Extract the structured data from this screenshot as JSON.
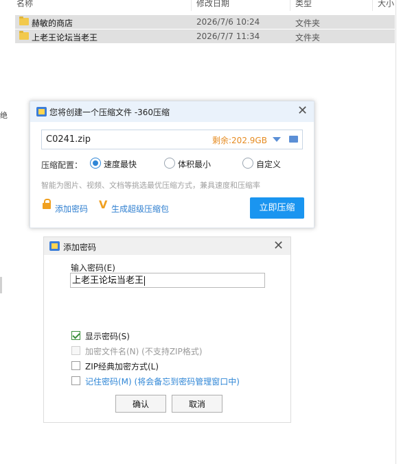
{
  "explorer": {
    "columns": [
      "名称",
      "修改日期",
      "类型",
      "大小"
    ],
    "files": [
      {
        "name": "赫敏的商店",
        "date": "2026/7/6 10:24",
        "type": "文件夹"
      },
      {
        "name": "上老王论坛当老王",
        "date": "2026/7/7 11:34",
        "type": "文件夹"
      }
    ],
    "side_char": "绝"
  },
  "compress_dialog": {
    "title": "您将创建一个压缩文件 -360压缩",
    "filename": "C0241.zip",
    "free_space": "剩余:202.9GB",
    "config_label": "压缩配置：",
    "options": [
      "速度最快",
      "体积最小",
      "自定义"
    ],
    "selected_option": "速度最快",
    "hint": "智能为图片、视频、文档等挑选最优压缩方式，兼具速度和压缩率",
    "add_password": "添加密码",
    "super_package": "生成超级压缩包",
    "compress_button": "立即压缩",
    "colors": {
      "primary": "#1a95f0",
      "accent": "#e58a1f"
    }
  },
  "password_dialog": {
    "title": "添加密码",
    "input_label": "输入密码(E)",
    "password_value": "上老王论坛当老王",
    "checkboxes": {
      "show_password": {
        "label": "显示密码(S)",
        "checked": true
      },
      "encrypt_filename": {
        "label": "加密文件名(N) (不支持ZIP格式)",
        "checked": false,
        "disabled": true
      },
      "zip_classic": {
        "label": "ZIP经典加密方式(L)",
        "checked": false
      },
      "remember": {
        "label": "记住密码(M) (将会备忘到密码管理窗口中)",
        "checked": false
      }
    },
    "ok_button": "确认",
    "cancel_button": "取消"
  }
}
